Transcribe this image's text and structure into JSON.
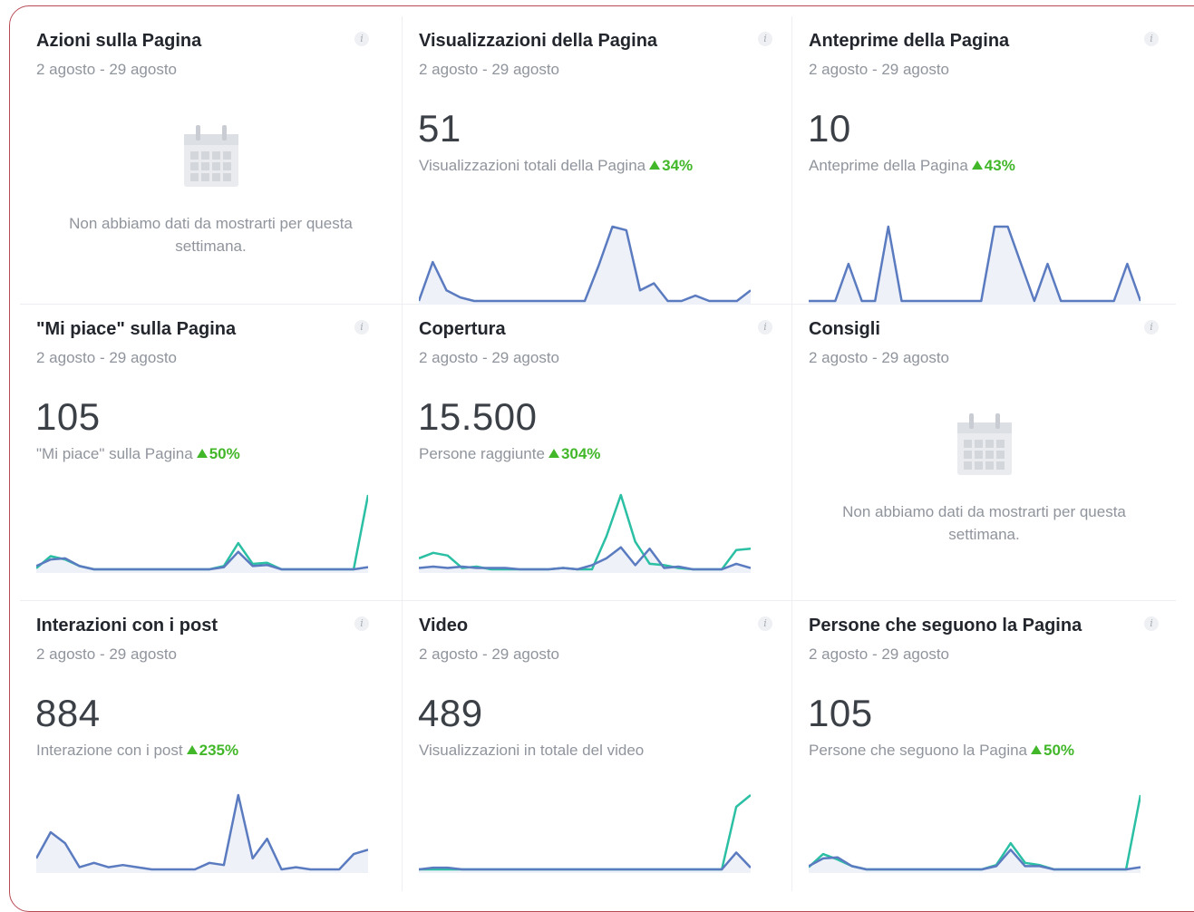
{
  "colors": {
    "line_blue": "#5b7bc0",
    "line_teal": "#2bbfa4",
    "fill": "#eef1f8",
    "positive": "#42b72a"
  },
  "cards": [
    {
      "title": "Azioni sulla Pagina",
      "date_range": "2 agosto - 29 agosto",
      "info_icon": "info-icon",
      "empty": true,
      "empty_icon": "calendar-icon",
      "empty_text": "Non abbiamo dati da mostrarti per questa settimana."
    },
    {
      "title": "Visualizzazioni della Pagina",
      "date_range": "2 agosto - 29 agosto",
      "info_icon": "info-icon",
      "value": "51",
      "metric_label": "Visualizzazioni totali della Pagina",
      "change": "34%",
      "chart_data": {
        "type": "line",
        "series": [
          {
            "values": [
              0,
              2.2,
              0.6,
              0.2,
              0,
              0,
              0,
              0,
              0,
              0,
              0,
              0,
              0,
              2,
              4.2,
              4,
              0.6,
              1,
              0,
              0,
              0.3,
              0,
              0,
              0,
              0.6
            ]
          }
        ]
      }
    },
    {
      "title": "Anteprime della Pagina",
      "date_range": "2 agosto - 29 agosto",
      "info_icon": "info-icon",
      "value": "10",
      "metric_label": "Anteprime della Pagina",
      "change": "43%",
      "chart_data": {
        "type": "line",
        "series": [
          {
            "values": [
              0,
              0,
              0,
              1,
              0,
              0,
              2,
              0,
              0,
              0,
              0,
              0,
              0,
              0,
              2,
              2,
              1,
              0,
              1,
              0,
              0,
              0,
              0,
              0,
              1,
              0
            ]
          }
        ]
      }
    },
    {
      "title": "\"Mi piace\" sulla Pagina",
      "date_range": "2 agosto - 29 agosto",
      "info_icon": "info-icon",
      "value": "105",
      "metric_label": "\"Mi piace\" sulla Pagina",
      "change": "50%",
      "chart_data": {
        "type": "line",
        "series": [
          {
            "values": [
              0.1,
              1.2,
              0.9,
              0.3,
              0,
              0,
              0,
              0,
              0,
              0,
              0,
              0,
              0,
              0.3,
              2.4,
              0.5,
              0.6,
              0,
              0,
              0,
              0,
              0,
              0,
              6.8
            ]
          },
          {
            "values": [
              0.3,
              0.9,
              1.0,
              0.3,
              0,
              0,
              0,
              0,
              0,
              0,
              0,
              0,
              0,
              0.2,
              1.6,
              0.3,
              0.4,
              0,
              0,
              0,
              0,
              0,
              0,
              0.2
            ]
          }
        ]
      }
    },
    {
      "title": "Copertura",
      "date_range": "2 agosto - 29 agosto",
      "info_icon": "info-icon",
      "value": "15.500",
      "metric_label": "Persone raggiunte",
      "change": "304%",
      "chart_data": {
        "type": "line",
        "series": [
          {
            "values": [
              0.8,
              1.2,
              1.0,
              0.1,
              0.2,
              0,
              0,
              0,
              0,
              0,
              0.1,
              0,
              0,
              2.4,
              5.4,
              2.0,
              0.4,
              0.3,
              0.1,
              0,
              0,
              0,
              1.4,
              1.5
            ]
          },
          {
            "values": [
              0.1,
              0.2,
              0.1,
              0.2,
              0.1,
              0.1,
              0.1,
              0,
              0,
              0,
              0.1,
              0,
              0.3,
              0.8,
              1.6,
              0.3,
              1.5,
              0.1,
              0.2,
              0,
              0,
              0,
              0.4,
              0.1
            ]
          }
        ]
      }
    },
    {
      "title": "Consigli",
      "date_range": "2 agosto - 29 agosto",
      "info_icon": "info-icon",
      "empty": true,
      "empty_icon": "calendar-icon",
      "empty_text": "Non abbiamo dati da mostrarti per questa settimana."
    },
    {
      "title": "Interazioni con i post",
      "date_range": "2 agosto - 29 agosto",
      "info_icon": "info-icon",
      "value": "884",
      "metric_label": "Interazione con i post",
      "change": "235%",
      "chart_data": {
        "type": "line",
        "series": [
          {
            "values": [
              0.5,
              1.7,
              1.2,
              0.1,
              0.3,
              0.1,
              0.2,
              0.1,
              0,
              0,
              0,
              0,
              0.3,
              0.2,
              3.4,
              0.5,
              1.4,
              0,
              0.1,
              0,
              0,
              0,
              0.7,
              0.9
            ]
          }
        ]
      }
    },
    {
      "title": "Video",
      "date_range": "2 agosto - 29 agosto",
      "info_icon": "info-icon",
      "value": "489",
      "metric_label": "Visualizzazioni in totale del video",
      "chart_data": {
        "type": "line",
        "series": [
          {
            "values": [
              0,
              0,
              0,
              0,
              0,
              0,
              0,
              0,
              0,
              0,
              0,
              0,
              0,
              0,
              0,
              0,
              0,
              0,
              0,
              0,
              0,
              0,
              3.7,
              4.4
            ]
          },
          {
            "values": [
              0,
              0.1,
              0.1,
              0,
              0,
              0,
              0,
              0,
              0,
              0,
              0,
              0,
              0,
              0,
              0,
              0,
              0,
              0,
              0,
              0,
              0,
              0,
              1.0,
              0.1
            ]
          }
        ]
      }
    },
    {
      "title": "Persone che seguono la Pagina",
      "date_range": "2 agosto - 29 agosto",
      "info_icon": "info-icon",
      "value": "105",
      "metric_label": "Persone che seguono la Pagina",
      "change": "50%",
      "chart_data": {
        "type": "line",
        "series": [
          {
            "values": [
              0.2,
              1.4,
              0.9,
              0.3,
              0,
              0,
              0,
              0,
              0,
              0,
              0,
              0,
              0,
              0.4,
              2.4,
              0.6,
              0.4,
              0,
              0,
              0,
              0,
              0,
              0,
              6.8
            ]
          },
          {
            "values": [
              0.3,
              1.0,
              1.1,
              0.3,
              0,
              0,
              0,
              0,
              0,
              0,
              0,
              0,
              0,
              0.3,
              1.8,
              0.3,
              0.3,
              0,
              0,
              0,
              0,
              0,
              0,
              0.2
            ]
          }
        ]
      }
    }
  ]
}
